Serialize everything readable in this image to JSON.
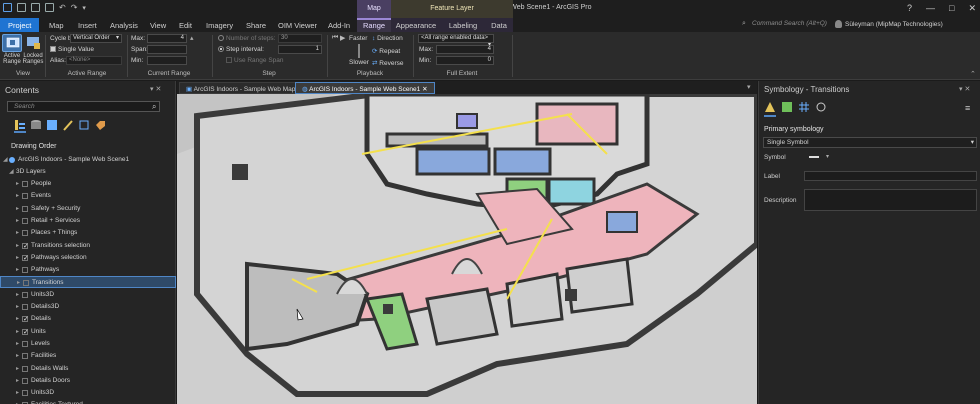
{
  "title_bar": {
    "title": "Cyberpark2 - ArcGIS Indoors - Sample Web Scene1 - ArcGIS Pro",
    "contextual_map": "Map",
    "contextual_feature_layer": "Feature Layer",
    "min": "—",
    "max": "□",
    "close": "✕",
    "help": "?"
  },
  "ribbon_tabs": [
    "Project",
    "Map",
    "Insert",
    "Analysis",
    "View",
    "Edit",
    "Imagery",
    "Share",
    "OIM Viewer",
    "Add-In",
    "Range",
    "Appearance",
    "Labeling",
    "Data"
  ],
  "command_search": "Command Search (Alt+Q)",
  "user": "Süleyman (MipMap Technologies)",
  "ribbon": {
    "view": {
      "active_range": "Active Range",
      "locked_ranges": "Locked Ranges",
      "label": "View"
    },
    "active_range": {
      "cycle_by_label": "Cycle by:",
      "cycle_by_value": "Vertical Order",
      "single_value": "Single Value",
      "alias_label": "Alias:",
      "alias_value": "<None>",
      "label": "Active Range"
    },
    "current_range": {
      "max_label": "Max:",
      "max_value": "4",
      "span_label": "Span:",
      "min_label": "Min:",
      "label": "Current Range"
    },
    "step": {
      "number_of_steps": "Number of steps:",
      "number_of_steps_value": "30",
      "step_interval": "Step interval:",
      "step_interval_value": "1",
      "use_range_span": "Use Range Span",
      "label": "Step"
    },
    "playback": {
      "faster": "Faster",
      "slower": "Slower",
      "direction": "Direction",
      "repeat": "Repeat",
      "reverse": "Reverse",
      "label": "Playback"
    },
    "full_extent": {
      "dropdown": "<All range enabled data>",
      "max_label": "Max:",
      "max_value": "4",
      "min_label": "Min:",
      "min_value": "0",
      "label": "Full Extent"
    }
  },
  "contents": {
    "title": "Contents",
    "search_placeholder": "Search",
    "drawing_order": "Drawing Order",
    "scene": "ArcGIS Indoors - Sample Web Scene1",
    "group": "3D Layers",
    "layers": [
      {
        "name": "People",
        "checked": false
      },
      {
        "name": "Events",
        "checked": false
      },
      {
        "name": "Safety + Security",
        "checked": false
      },
      {
        "name": "Retail + Services",
        "checked": false
      },
      {
        "name": "Places + Things",
        "checked": false
      },
      {
        "name": "Transitions selection",
        "checked": true
      },
      {
        "name": "Pathways selection",
        "checked": true
      },
      {
        "name": "Pathways",
        "checked": false
      },
      {
        "name": "Transitions",
        "checked": false,
        "selected": true
      },
      {
        "name": "Units3D",
        "checked": false
      },
      {
        "name": "Details3D",
        "checked": false
      },
      {
        "name": "Details",
        "checked": true
      },
      {
        "name": "Units",
        "checked": true
      },
      {
        "name": "Levels",
        "checked": false
      },
      {
        "name": "Facilities",
        "checked": false
      },
      {
        "name": "Details Walls",
        "checked": false
      },
      {
        "name": "Details Doors",
        "checked": false
      },
      {
        "name": "Units3D",
        "checked": false
      },
      {
        "name": "Facilities Textured",
        "checked": false
      }
    ]
  },
  "map_tabs": [
    "ArcGIS Indoors - Sample Web Map",
    "ArcGIS Indoors - Sample Web Scene1"
  ],
  "symbology": {
    "title": "Symbology - Transitions",
    "primary": "Primary symbology",
    "renderer": "Single Symbol",
    "symbol_label": "Symbol",
    "label_label": "Label",
    "description_label": "Description"
  },
  "colors": {
    "project_tab": "#1f74d2",
    "range_context": "#4a3f62",
    "selection": "#2f4a68",
    "pathway_yellow": "#f4e04d",
    "unit_pink": "#eeb4bc",
    "unit_blue": "#7f9fd6",
    "unit_green": "#8fd07f"
  }
}
